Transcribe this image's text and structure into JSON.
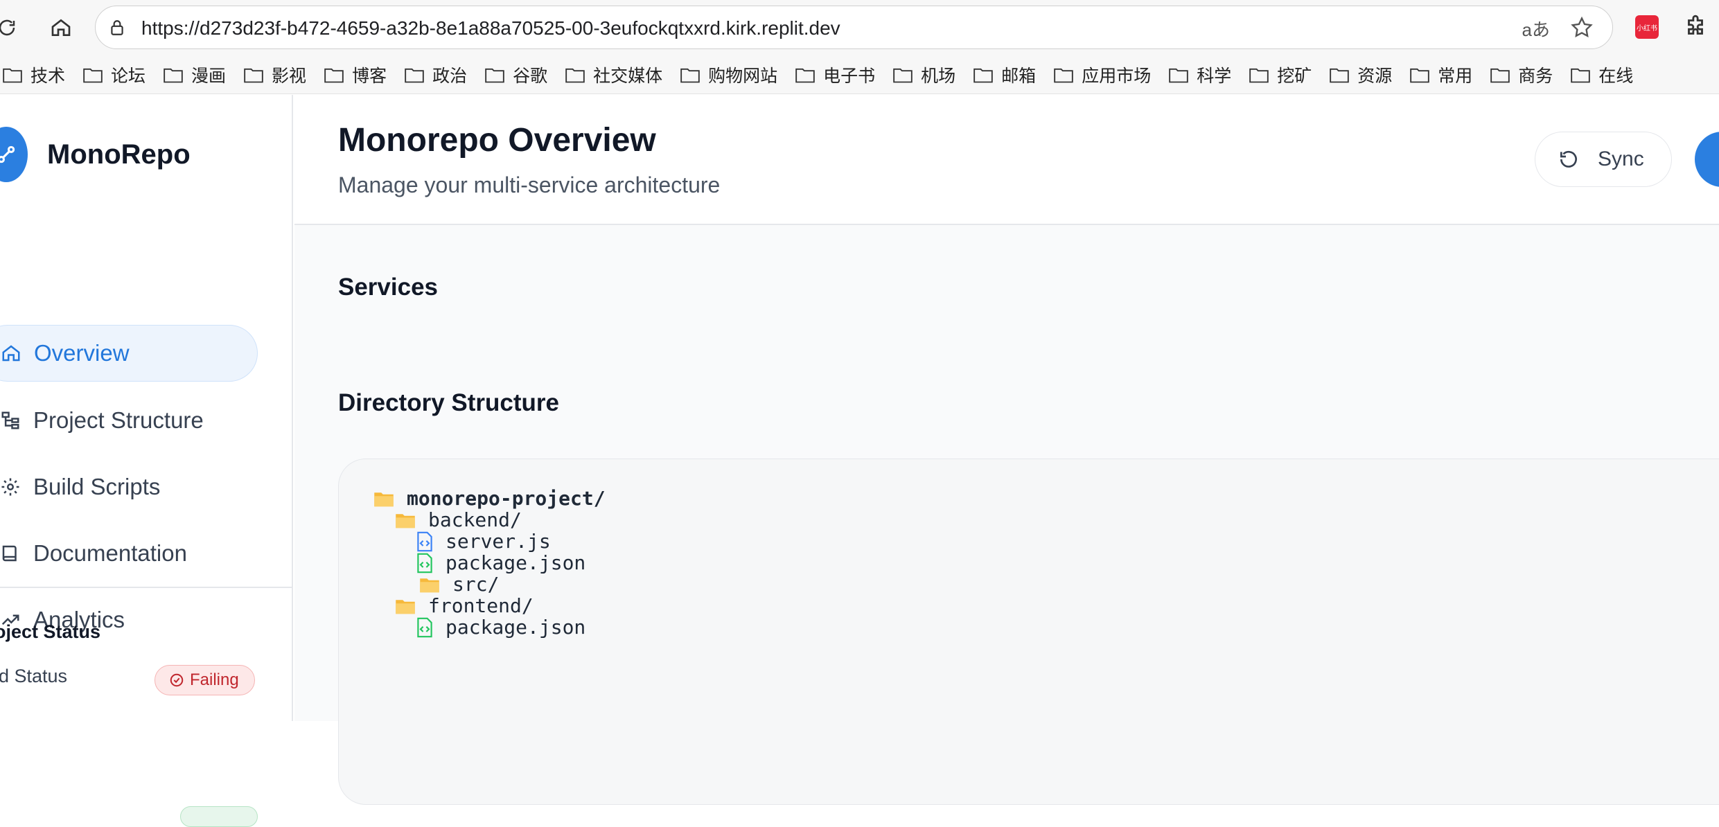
{
  "browser": {
    "url": "https://d273d23f-b472-4659-a32b-8e1a88a70525-00-3eufockqtxxrd.kirk.replit.dev",
    "translate_label": "aあ",
    "extension_label": "小红书",
    "bookmarks": [
      "技术",
      "论坛",
      "漫画",
      "影视",
      "博客",
      "政治",
      "谷歌",
      "社交媒体",
      "购物网站",
      "电子书",
      "机场",
      "邮箱",
      "应用市场",
      "科学",
      "挖矿",
      "资源",
      "常用",
      "商务",
      "在线"
    ]
  },
  "sidebar": {
    "brand": "MonoRepo",
    "items": [
      {
        "label": "Overview",
        "icon": "home-icon",
        "active": true
      },
      {
        "label": "Project Structure",
        "icon": "structure-icon",
        "active": false
      },
      {
        "label": "Build Scripts",
        "icon": "gear-icon",
        "active": false
      },
      {
        "label": "Documentation",
        "icon": "book-icon",
        "active": false
      },
      {
        "label": "Analytics",
        "icon": "trend-icon",
        "active": false
      }
    ],
    "status_title": "oject Status",
    "build_status_label": "ld Status",
    "build_status_value": "Failing"
  },
  "header": {
    "title": "Monorepo Overview",
    "subtitle": "Manage your multi-service architecture",
    "sync_label": "Sync"
  },
  "main": {
    "services_title": "Services",
    "directory_title": "Directory Structure",
    "tree": [
      {
        "name": "monorepo-project/",
        "type": "folder",
        "depth": 0
      },
      {
        "name": "backend/",
        "type": "folder",
        "depth": 1
      },
      {
        "name": "server.js",
        "type": "js-file",
        "depth": 2
      },
      {
        "name": "package.json",
        "type": "json-file",
        "depth": 2
      },
      {
        "name": "src/",
        "type": "folder",
        "depth": 2
      },
      {
        "name": "frontend/",
        "type": "folder",
        "depth": 1
      },
      {
        "name": "package.json",
        "type": "json-file",
        "depth": 2
      }
    ]
  },
  "colors": {
    "accent": "#2b7fe0",
    "failing": "#c0262d",
    "folder": "#f6b93b",
    "js_file": "#3b82f6",
    "json_file": "#22c55e"
  }
}
